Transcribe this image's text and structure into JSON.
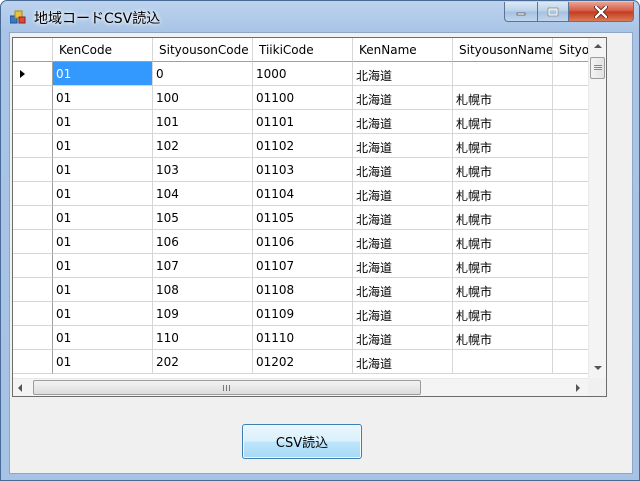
{
  "window": {
    "title": "地域コードCSV読込",
    "colors": {
      "titlebar": "#a9c4e6",
      "close": "#c23b1f",
      "selection": "#3399ff"
    }
  },
  "grid": {
    "columns": [
      "KenCode",
      "SityousonCode",
      "TiikiCode",
      "KenName",
      "SityousonName",
      "Sityouson"
    ],
    "rows": [
      [
        "01",
        "0",
        "1000",
        "北海道",
        "",
        ""
      ],
      [
        "01",
        "100",
        "01100",
        "北海道",
        "札幌市",
        ""
      ],
      [
        "01",
        "101",
        "01101",
        "北海道",
        "札幌市",
        ""
      ],
      [
        "01",
        "102",
        "01102",
        "北海道",
        "札幌市",
        ""
      ],
      [
        "01",
        "103",
        "01103",
        "北海道",
        "札幌市",
        ""
      ],
      [
        "01",
        "104",
        "01104",
        "北海道",
        "札幌市",
        ""
      ],
      [
        "01",
        "105",
        "01105",
        "北海道",
        "札幌市",
        ""
      ],
      [
        "01",
        "106",
        "01106",
        "北海道",
        "札幌市",
        ""
      ],
      [
        "01",
        "107",
        "01107",
        "北海道",
        "札幌市",
        ""
      ],
      [
        "01",
        "108",
        "01108",
        "北海道",
        "札幌市",
        ""
      ],
      [
        "01",
        "109",
        "01109",
        "北海道",
        "札幌市",
        ""
      ],
      [
        "01",
        "110",
        "01110",
        "北海道",
        "札幌市",
        ""
      ],
      [
        "01",
        "202",
        "01202",
        "北海道",
        "",
        ""
      ]
    ]
  },
  "button": {
    "csv_label": "CSV読込"
  }
}
